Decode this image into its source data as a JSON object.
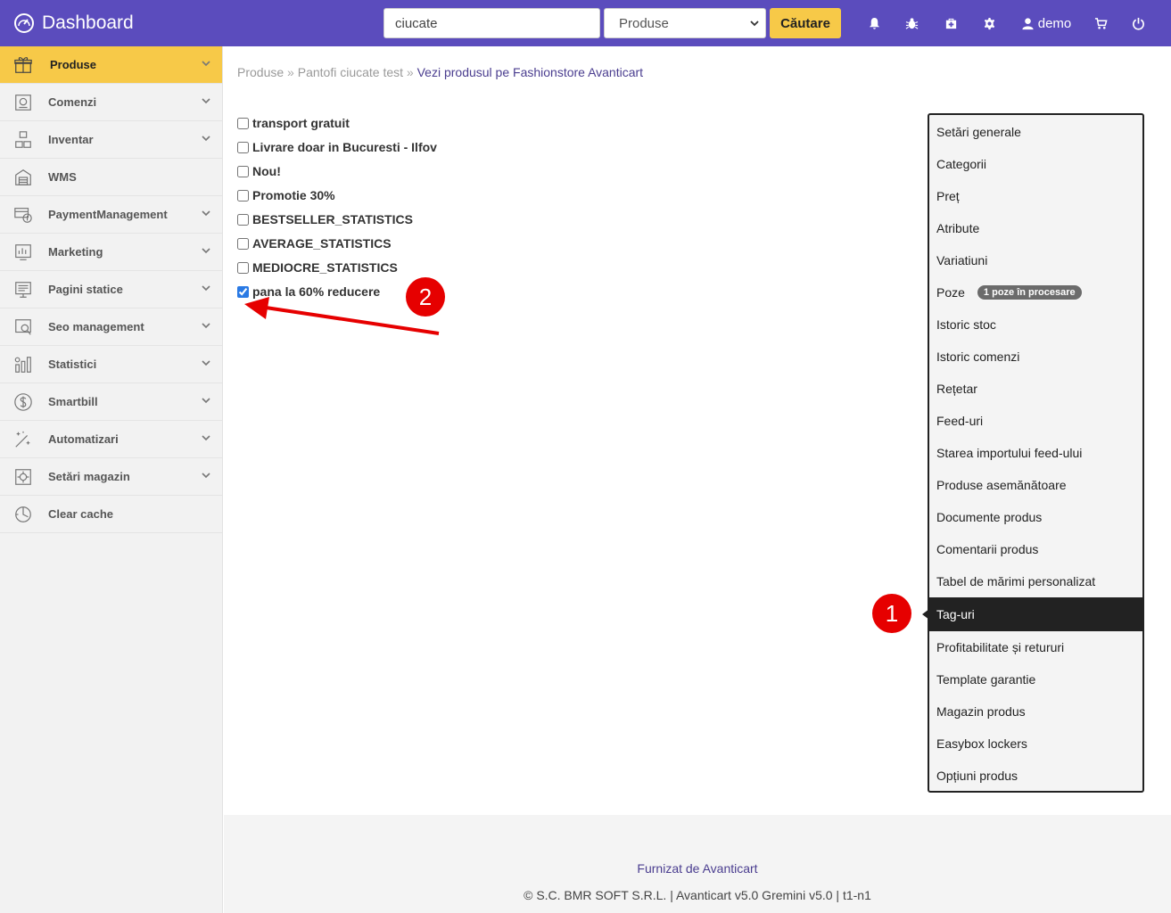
{
  "header": {
    "title": "Dashboard",
    "search_value": "ciucate",
    "search_scope": "Produse",
    "search_button": "Căutare",
    "user": "demo",
    "brand_color": "#5b4cbd",
    "accent_color": "#f7c948"
  },
  "sidebar": {
    "items": [
      {
        "label": "Produse",
        "icon": "gift-icon",
        "active": true
      },
      {
        "label": "Comenzi",
        "icon": "orders-icon"
      },
      {
        "label": "Inventar",
        "icon": "boxes-icon"
      },
      {
        "label": "WMS",
        "icon": "warehouse-icon"
      },
      {
        "label": "PaymentManagement",
        "icon": "payment-icon"
      },
      {
        "label": "Marketing",
        "icon": "marketing-icon"
      },
      {
        "label": "Pagini statice",
        "icon": "page-icon"
      },
      {
        "label": "Seo management",
        "icon": "seo-icon"
      },
      {
        "label": "Statistici",
        "icon": "stats-icon"
      },
      {
        "label": "Smartbill",
        "icon": "dollar-icon"
      },
      {
        "label": "Automatizari",
        "icon": "magic-wand-icon"
      },
      {
        "label": "Setări magazin",
        "icon": "settings-icon"
      },
      {
        "label": "Clear cache",
        "icon": "cache-icon"
      }
    ]
  },
  "breadcrumb": {
    "part1": "Produse",
    "separator": "»",
    "part2": "Pantofi ciucate test",
    "part3": "Vezi produsul pe Fashionstore Avanticart"
  },
  "tags": [
    {
      "label": "transport gratuit",
      "checked": false
    },
    {
      "label": "Livrare doar in Bucuresti - Ilfov",
      "checked": false
    },
    {
      "label": "Nou!",
      "checked": false
    },
    {
      "label": "Promotie 30%",
      "checked": false
    },
    {
      "label": "BESTSELLER_STATISTICS",
      "checked": false
    },
    {
      "label": "AVERAGE_STATISTICS",
      "checked": false
    },
    {
      "label": "MEDIOCRE_STATISTICS",
      "checked": false
    },
    {
      "label": "pana la 60% reducere",
      "checked": true
    }
  ],
  "product_menu": {
    "items": [
      "Setări generale",
      "Categorii",
      "Preț",
      "Atribute",
      "Variatiuni",
      "Poze",
      "Istoric stoc",
      "Istoric comenzi",
      "Rețetar",
      "Feed-uri",
      "Starea importului feed-ului",
      "Produse asemănătoare",
      "Documente produs",
      "Comentarii produs",
      "Tabel de mărimi personalizat",
      "Tag-uri",
      "Profitabilitate și retururi",
      "Template garantie",
      "Magazin produs",
      "Easybox lockers",
      "Opțiuni produs"
    ],
    "active_item": "Tag-uri",
    "poze_badge": "1 poze în procesare"
  },
  "annotations": {
    "marker1": "1",
    "marker2": "2",
    "color": "#e60000"
  },
  "footer": {
    "link": "Furnizat de Avanticart",
    "copyright": "© S.C. BMR SOFT S.R.L. | Avanticart v5.0 Gremini v5.0 | t1-n1"
  }
}
